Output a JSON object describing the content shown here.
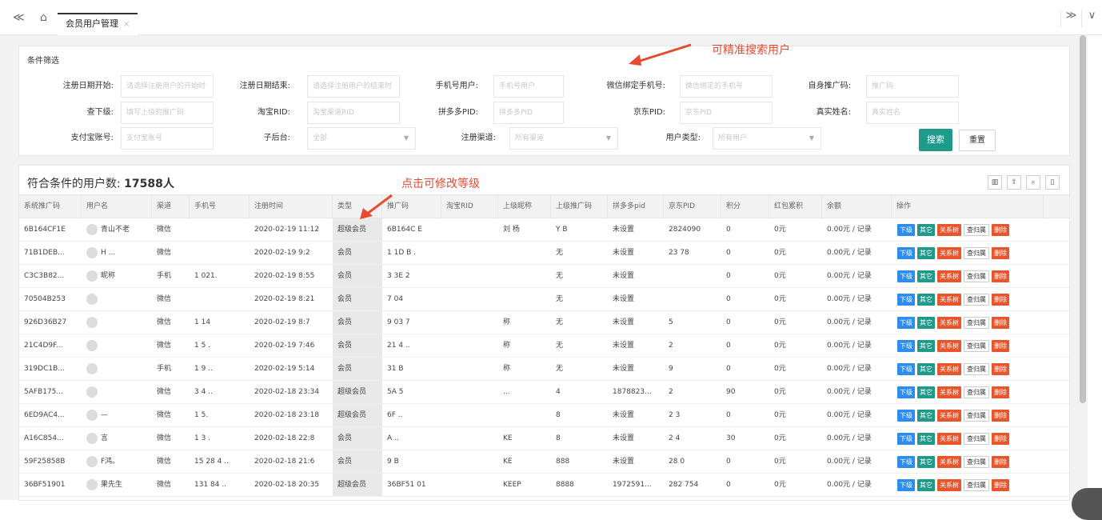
{
  "tabs": {
    "home_label": "⌂",
    "active": "会员用户管理",
    "close": "×"
  },
  "nav": {
    "back": "≪",
    "forward": "≫",
    "down": "∨"
  },
  "filter": {
    "title": "条件筛选",
    "fields": [
      {
        "label": "注册日期开始:",
        "placeholder": "请选择注册用户的开始时"
      },
      {
        "label": "注册日期结束:",
        "placeholder": "请选择注册用户的结束时"
      },
      {
        "label": "手机号用户:",
        "placeholder": "手机号用户"
      },
      {
        "label": "微信绑定手机号:",
        "placeholder": "微信绑定的手机号"
      },
      {
        "label": "自身推广码:",
        "placeholder": "推广码"
      },
      {
        "label": "查下级:",
        "placeholder": "填写上级的推广码"
      },
      {
        "label": "淘宝RID:",
        "placeholder": "淘宝渠道RID"
      },
      {
        "label": "拼多多PID:",
        "placeholder": "拼多多PID"
      },
      {
        "label": "京东PID:",
        "placeholder": "京东PID"
      },
      {
        "label": "真实姓名:",
        "placeholder": "真实姓名"
      },
      {
        "label": "支付宝账号:",
        "placeholder": "支付宝账号"
      },
      {
        "label": "子后台:",
        "placeholder": "全部"
      },
      {
        "label": "注册渠道:",
        "placeholder": "所有渠道"
      },
      {
        "label": "用户类型:",
        "placeholder": "所有用户"
      }
    ],
    "search": "搜索",
    "reset": "重置"
  },
  "annotations": {
    "search_note": "可精准搜索用户",
    "level_note": "点击可修改等级"
  },
  "table": {
    "count_label": "符合条件的用户数:",
    "count": "17588人",
    "tool_icons": [
      "filter-columns-icon",
      "export-icon",
      "search-icon",
      "print-icon"
    ],
    "headers": [
      "系统推广码",
      "用户名",
      "渠道",
      "手机号",
      "注册时间",
      "类型",
      "推广码",
      "淘宝RID",
      "上级昵称",
      "上级推广码",
      "拼多多pid",
      "京东PID",
      "积分",
      "红包累积",
      "余额",
      "操作"
    ],
    "rows": [
      [
        "6B164CF1E",
        "青山不老",
        "微信",
        "",
        "2020-02-19 11:12",
        "超级会员",
        "6B164C E",
        "",
        "刘 杨",
        "Y B",
        "未设置",
        "2824090",
        "0",
        "0元",
        "0.00元 / 记录"
      ],
      [
        "71B1DEB...",
        "H ...",
        "微信",
        "",
        "2020-02-19 9:2",
        "会员",
        "1 1D B .",
        "",
        "",
        "无",
        "未设置",
        " 23 78",
        "0",
        "0元",
        "0.00元 / 记录"
      ],
      [
        "C3C3B82...",
        "昵称",
        "手机",
        "1 021.",
        "2020-02-19 8:55",
        "会员",
        "3 3E 2",
        "",
        "",
        "无",
        "未设置",
        "",
        "0",
        "0元",
        "0.00元 / 记录"
      ],
      [
        "70504B253",
        "",
        "微信",
        "",
        "2020-02-19 8:21",
        "会员",
        "7 04",
        "",
        "",
        "无",
        "未设置",
        "",
        "0",
        "0元",
        "0.00元 / 记录"
      ],
      [
        "926D36B27",
        "",
        "微信",
        "1 14",
        "2020-02-19 8:7",
        "会员",
        "9 03 7",
        "",
        "称",
        "无",
        "未设置",
        " 5",
        "0",
        "0元",
        "0.00元 / 记录"
      ],
      [
        "21C4D9F...",
        "",
        "微信",
        "1 5 .",
        "2020-02-19 7:46",
        "会员",
        "21 4 ..",
        "",
        "称",
        "无",
        "未设置",
        " 2",
        "0",
        "0元",
        "0.00元 / 记录"
      ],
      [
        "319DC1B...",
        "",
        "手机",
        "1 9 ..",
        "2020-02-19 5:14",
        "会员",
        "31 B",
        "",
        "称",
        "无",
        "未设置",
        " 9",
        "0",
        "0元",
        "0.00元 / 记录"
      ],
      [
        "5AFB175...",
        "",
        "微信",
        "3 4 ..",
        "2020-02-18 23:34",
        "超级会员",
        "5A 5",
        "",
        "...",
        "4",
        "1878823...",
        "2",
        "90",
        "0元",
        "0.00元 / 记录"
      ],
      [
        "6ED9AC4...",
        "—",
        "微信",
        "1 5.",
        "2020-02-18 23:18",
        "超级会员",
        "6F ..",
        "",
        "",
        "8",
        "未设置",
        "2 3",
        "0",
        "0元",
        "0.00元 / 记录"
      ],
      [
        "A16C854...",
        "言",
        "微信",
        "1 3 .",
        "2020-02-18 22:8",
        "会员",
        "A ..",
        "",
        "KE",
        "8",
        "未设置",
        "2 4",
        "30",
        "0元",
        "0.00元 / 记录"
      ],
      [
        "59F25858B",
        "F鸿。",
        "微信",
        "15 28 4 ..",
        "2020-02-18 21:6",
        "会员",
        "9 B",
        "",
        "KE",
        "888",
        "未设置",
        "28 0",
        "0",
        "0元",
        "0.00元 / 记录"
      ],
      [
        "36BF51901",
        "果先生",
        "微信",
        "131 84 ..",
        "2020-02-18 20:35",
        "超级会员",
        "36BF51 01",
        "",
        "KEEP",
        "8888",
        "1972591...",
        "282 754",
        "0",
        "0元",
        "0.00元 / 记录"
      ]
    ],
    "ops": [
      "下级",
      "其它",
      "关系树",
      "查归属",
      "删除"
    ]
  }
}
